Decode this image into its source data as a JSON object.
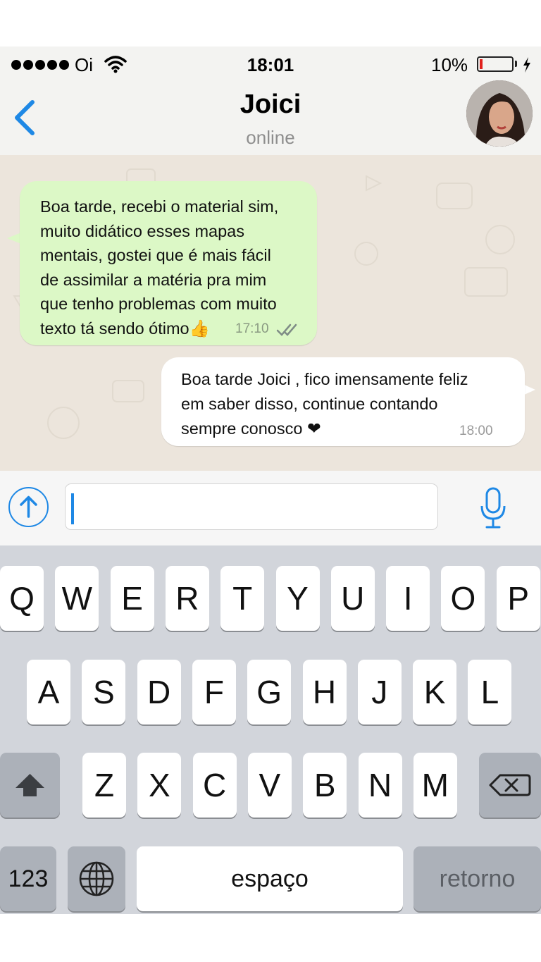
{
  "status_bar": {
    "carrier": "Oi",
    "time": "18:01",
    "battery": "10%",
    "battery_level": 0.1
  },
  "header": {
    "back_icon": "chevron-left-icon",
    "contact_name": "Joici",
    "status": "online"
  },
  "messages": [
    {
      "direction": "incoming",
      "text": "Boa tarde, recebi o material sim,\nmuito didático esses mapas\nmentais, gostei que é mais fácil\nde assimilar a matéria pra mim\nque tenho problemas com muito\ntexto tá sendo ótimo👍",
      "time": "17:10",
      "receipt": "double-check-icon"
    },
    {
      "direction": "outgoing",
      "text": "Boa tarde Joici , fico imensamente feliz\nem saber disso, continue contando\nsempre conosco ❤",
      "time": "18:00"
    }
  ],
  "input": {
    "value": "",
    "upload_icon": "arrow-up-circle-icon",
    "mic_icon": "microphone-icon"
  },
  "keyboard": {
    "row1": [
      "Q",
      "W",
      "E",
      "R",
      "T",
      "Y",
      "U",
      "I",
      "O",
      "P"
    ],
    "row2": [
      "A",
      "S",
      "D",
      "F",
      "G",
      "H",
      "J",
      "K",
      "L"
    ],
    "row3": [
      "Z",
      "X",
      "C",
      "V",
      "B",
      "N",
      "M"
    ],
    "shift_icon": "shift-arrow-icon",
    "backspace_icon": "backspace-icon",
    "numbers_label": "123",
    "globe_icon": "globe-icon",
    "space_label": "espaço",
    "return_label": "retorno"
  },
  "colors": {
    "accent": "#1e88e5",
    "incoming_bubble": "#dcf8c6",
    "outgoing_bubble": "#ffffff",
    "chat_background": "#ece5dc",
    "battery_low": "#e0201c"
  }
}
